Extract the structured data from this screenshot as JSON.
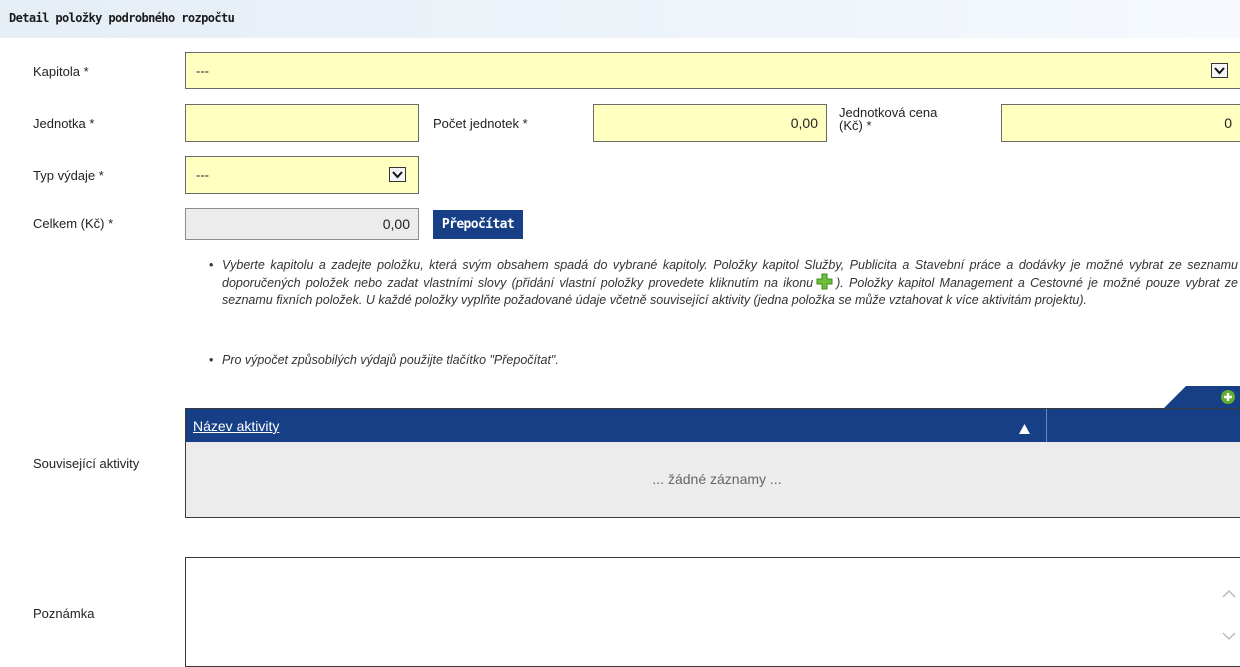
{
  "header": {
    "title": "Detail položky podrobného rozpočtu"
  },
  "form": {
    "kapitola": {
      "label": "Kapitola *",
      "value": "---"
    },
    "jednotka": {
      "label": "Jednotka *",
      "value": ""
    },
    "pocet": {
      "label": "Počet jednotek *",
      "value": "0,00"
    },
    "cena": {
      "label_line1": "Jednotková cena",
      "label_line2": "(Kč) *",
      "value": "0"
    },
    "typ": {
      "label": "Typ výdaje *",
      "value": "---"
    },
    "celkem": {
      "label": "Celkem (Kč) *",
      "value": "0,00"
    },
    "recalc_label": "Přepočítat"
  },
  "help": {
    "bullet1_a": "Vyberte kapitolu a zadejte položku, která svým obsahem spadá do vybrané kapitoly. Položky kapitol Služby, Publicita a Stavební práce a dodávky je možné vybrat ze seznamu doporučených položek nebo zadat vlastními slovy (přidání vlastní položky provedete kliknutím na ikonu",
    "bullet1_b": "). Položky kapitol Management a Cestovné je možné pouze vybrat ze seznamu fixních položek. U každé položky vyplňte požadované údaje včetně související aktivity (jedna položka se může vztahovat k více aktivitám projektu).",
    "bullet2": "Pro výpočet způsobilých výdajů použijte tlačítko \"Přepočítat\"."
  },
  "activities": {
    "label": "Související aktivity",
    "column_name": "Název aktivity",
    "empty_text": "... žádné záznamy ..."
  },
  "note": {
    "label": "Poznámka",
    "value": ""
  },
  "icons": {
    "add": "plus-circle-icon",
    "dropdown": "chevron-down-icon",
    "sort": "triangle-up-icon",
    "inline_plus": "green-plus-icon"
  },
  "colors": {
    "accent": "#173f86",
    "field_bg": "#ffffc0",
    "add_green": "#5fb030"
  }
}
